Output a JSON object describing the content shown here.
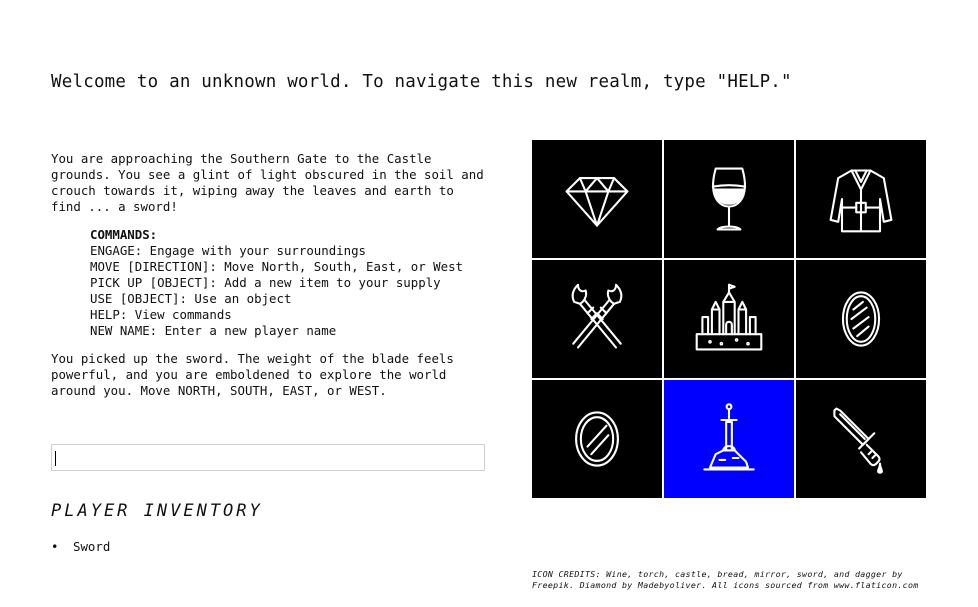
{
  "welcome": "Welcome to an unknown world. To navigate this new realm, type \"HELP.\"",
  "story": {
    "intro": "You are approaching the Southern Gate to the Castle grounds. You see a glint of light obscured in the soil and crouch towards it, wiping away the leaves and earth to find ... a sword!",
    "result": "You picked up the sword. The weight of the blade feels powerful, and you are emboldened to explore the world around you. Move NORTH, SOUTH, EAST, or WEST."
  },
  "commands": {
    "title": "COMMANDS:",
    "items": [
      "ENGAGE: Engage with your surroundings",
      "MOVE [DIRECTION]: Move North, South, East, or West",
      "PICK UP [OBJECT]: Add a new item to your supply",
      "USE [OBJECT]: Use an object",
      "HELP: View commands",
      "NEW NAME: Enter a new player name"
    ]
  },
  "input": {
    "value": "",
    "placeholder": ""
  },
  "inventory": {
    "title": "PLAYER INVENTORY",
    "items": [
      "Sword"
    ]
  },
  "map": {
    "tiles": [
      {
        "icon": "diamond-icon",
        "active": false
      },
      {
        "icon": "wine-icon",
        "active": false
      },
      {
        "icon": "jacket-icon",
        "active": false
      },
      {
        "icon": "torches-icon",
        "active": false
      },
      {
        "icon": "castle-icon",
        "active": false
      },
      {
        "icon": "bread-icon",
        "active": false
      },
      {
        "icon": "mirror-icon",
        "active": false
      },
      {
        "icon": "sword-in-stone-icon",
        "active": true
      },
      {
        "icon": "dagger-icon",
        "active": false
      }
    ],
    "tile_color": "#000000",
    "active_color": "#0000ff"
  },
  "credits": "ICON CREDITS: Wine, torch, castle, bread, mirror, sword, and dagger by Freepik. Diamond by Madebyoliver. All icons sourced from www.flaticon.com"
}
